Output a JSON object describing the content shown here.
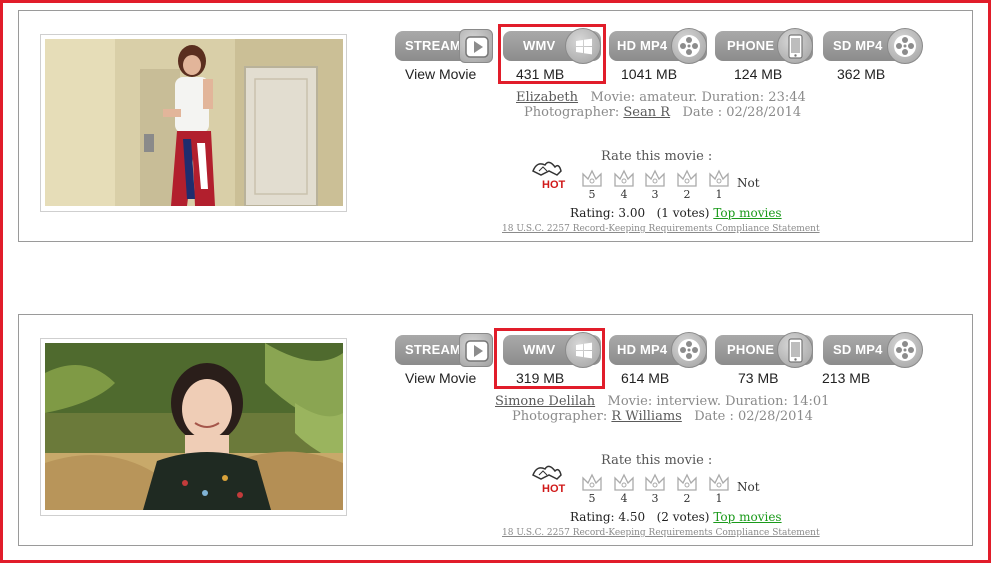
{
  "movies": [
    {
      "stream_label": "STREAM",
      "view_movie": "View Movie",
      "formats": [
        {
          "label": "WMV",
          "size": "431 MB"
        },
        {
          "label": "HD MP4",
          "size": "1041 MB"
        },
        {
          "label": "PHONE",
          "size": "124 MB"
        },
        {
          "label": "SD MP4",
          "size": "362 MB"
        }
      ],
      "model": "Elizabeth",
      "movie_info": "Movie: amateur. Duration: 23:44",
      "photographer_label": "Photographer:",
      "photographer": "Sean R",
      "date": "Date : 02/28/2014",
      "rate_title": "Rate this movie :",
      "hot_label": "HOT",
      "stars": [
        "5",
        "4",
        "3",
        "2",
        "1"
      ],
      "not_label": "Not",
      "rating": "Rating: 3.00",
      "votes": "(1 votes)",
      "top_movies": "Top movies",
      "compliance": "18 U.S.C. 2257 Record-Keeping Requirements Compliance Statement"
    },
    {
      "stream_label": "STREAM",
      "view_movie": "View Movie",
      "formats": [
        {
          "label": "WMV",
          "size": "319 MB"
        },
        {
          "label": "HD MP4",
          "size": "614 MB"
        },
        {
          "label": "PHONE",
          "size": "73 MB"
        },
        {
          "label": "SD MP4",
          "size": "213 MB"
        }
      ],
      "model": "Simone Delilah",
      "movie_info": "Movie: interview. Duration: 14:01",
      "photographer_label": "Photographer:",
      "photographer": "R Williams",
      "date": "Date : 02/28/2014",
      "rate_title": "Rate this movie :",
      "hot_label": "HOT",
      "stars": [
        "5",
        "4",
        "3",
        "2",
        "1"
      ],
      "not_label": "Not",
      "rating": "Rating: 4.50",
      "votes": "(2 votes)",
      "top_movies": "Top movies",
      "compliance": "18 U.S.C. 2257 Record-Keeping Requirements Compliance Statement"
    }
  ],
  "icons": {
    "stream": "play-icon",
    "wmv": "windows-icon",
    "hd_mp4": "film-reel-icon",
    "phone": "smartphone-icon",
    "sd_mp4": "film-reel-icon",
    "hot": "hot-icon",
    "rating": "crown-icon"
  },
  "colors": {
    "highlight": "#e11d2a",
    "button": "#9b9b9b",
    "top_movies_link": "#1a9a1a"
  }
}
